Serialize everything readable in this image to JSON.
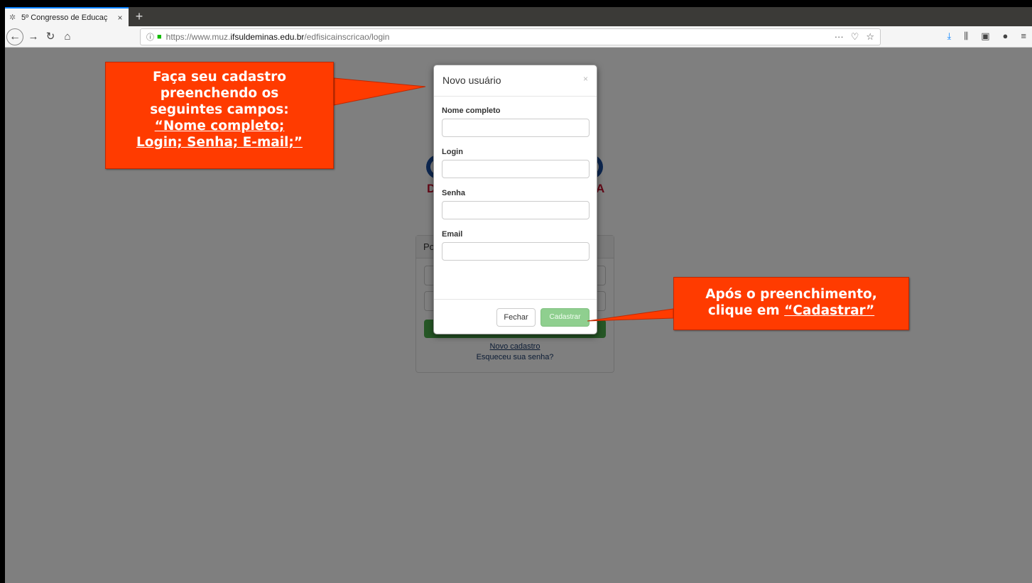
{
  "browser": {
    "tab_title": "5º Congresso de Educaç",
    "tab_close": "×",
    "new_tab": "+",
    "url_prefix": "https://www.muz.",
    "url_host": "ifsuldeminas.edu.br",
    "url_path": "/edfisicainscricao/login",
    "url_actions": "··· ☆",
    "icons": [
      "back-icon",
      "forward-icon",
      "reload-icon",
      "home-icon",
      "info-icon",
      "lock-icon",
      "pocket-icon",
      "bookmark-star-icon",
      "download-icon",
      "library-icon",
      "sidebar-icon",
      "extension-icon",
      "menu-icon"
    ]
  },
  "page": {
    "logo_left_letter": "D",
    "logo_right_letter": "A",
    "panel_head": "Po",
    "novo_cadastro": "Novo cadastro",
    "esqueceu": "Esqueceu sua senha?"
  },
  "modal": {
    "title": "Novo usuário",
    "close": "×",
    "fields": {
      "nome_label": "Nome completo",
      "nome_value": "",
      "login_label": "Login",
      "login_value": "",
      "senha_label": "Senha",
      "senha_value": "",
      "email_label": "Email",
      "email_value": ""
    },
    "fechar_label": "Fechar",
    "cadastrar_label": "Cadastrar"
  },
  "callouts": {
    "first_line1": "Faça seu cadastro",
    "first_line2": "preenchendo os",
    "first_line3": "seguintes campos:",
    "first_line4": "“Nome completo;",
    "first_line5": "Login; Senha; E-mail;”",
    "second_line1": "Após o preenchimento,",
    "second_line2_prefix": "clique em ",
    "second_line2_link": "“Cadastrar”"
  },
  "colors": {
    "callout": "#ff3b00",
    "backdrop": "#7f7f7f",
    "success": "#8fcf8f"
  }
}
